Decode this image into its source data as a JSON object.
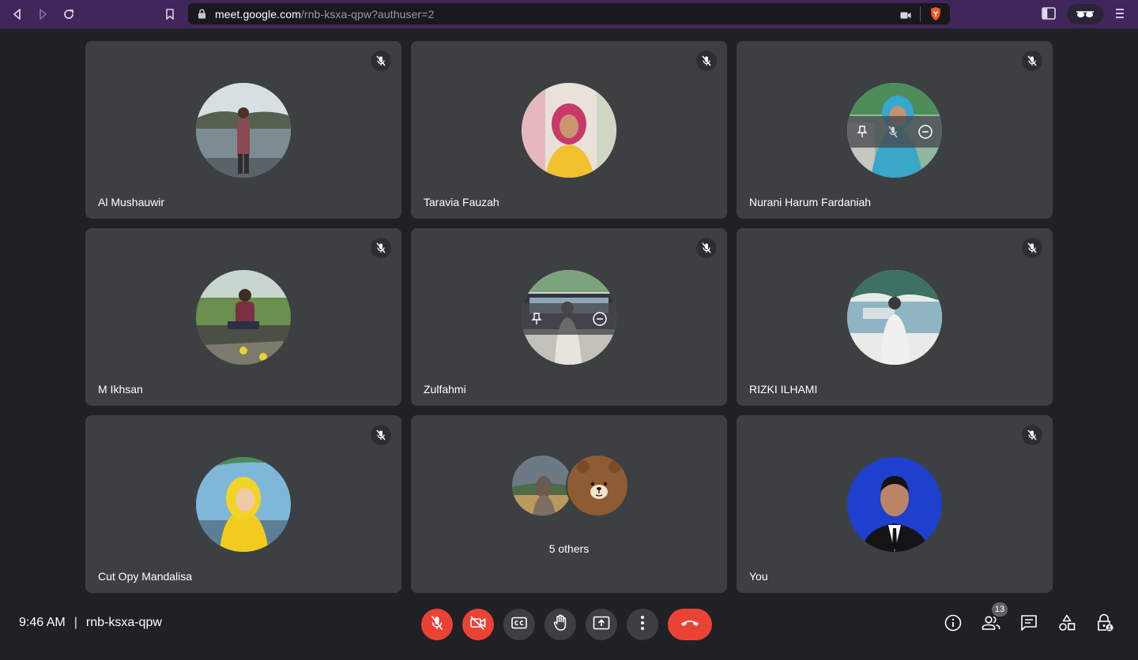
{
  "browser": {
    "url_host": "meet.google.com",
    "url_path": "/rnb-ksxa-qpw?authuser=2"
  },
  "participants": [
    {
      "name": "Al Mushauwir",
      "muted": true
    },
    {
      "name": "Taravia Fauzah",
      "muted": true
    },
    {
      "name": "Nurani Harum Fardaniah",
      "muted": true
    },
    {
      "name": "M Ikhsan",
      "muted": true
    },
    {
      "name": "Zulfahmi",
      "muted": true
    },
    {
      "name": "RIZKI ILHAMI",
      "muted": true
    },
    {
      "name": "Cut Opy Mandalisa",
      "muted": true
    },
    {
      "name": "5 others",
      "muted": false
    },
    {
      "name": "You",
      "muted": true
    }
  ],
  "meeting": {
    "time": "9:46 AM",
    "separator": "|",
    "code": "rnb-ksxa-qpw",
    "people_count": "13"
  },
  "controls": [
    {
      "name": "mic-off",
      "state": "off"
    },
    {
      "name": "camera-off",
      "state": "off"
    },
    {
      "name": "captions"
    },
    {
      "name": "raise-hand"
    },
    {
      "name": "present-screen"
    },
    {
      "name": "more-options"
    },
    {
      "name": "leave-call"
    }
  ],
  "colors": {
    "background": "#202124",
    "tile": "#3c4043",
    "danger": "#ea4335",
    "browser_bar": "#40265a",
    "brave_accent": "#fb542b"
  }
}
